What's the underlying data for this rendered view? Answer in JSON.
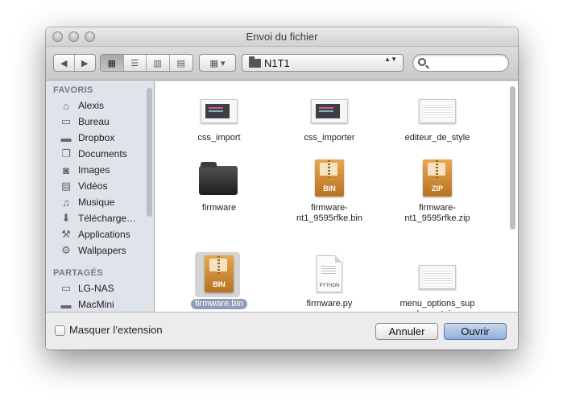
{
  "window": {
    "title": "Envoi du fichier"
  },
  "toolbar": {
    "location": "N1T1",
    "search_placeholder": "",
    "nav_back": "◀",
    "nav_forward": "▶",
    "view_icons": "▦",
    "view_list": "☰",
    "view_columns": "▥",
    "view_coverflow": "▤",
    "arrange": "▦ ▾",
    "location_arrows": "▲▼"
  },
  "sidebar": {
    "sections": [
      {
        "title": "FAVORIS",
        "items": [
          {
            "label": "Alexis",
            "icon": "home-icon"
          },
          {
            "label": "Bureau",
            "icon": "desktop-icon"
          },
          {
            "label": "Dropbox",
            "icon": "folder-icon"
          },
          {
            "label": "Documents",
            "icon": "documents-icon"
          },
          {
            "label": "Images",
            "icon": "camera-icon"
          },
          {
            "label": "Vidéos",
            "icon": "film-icon"
          },
          {
            "label": "Musique",
            "icon": "music-icon"
          },
          {
            "label": "Télécharge…",
            "icon": "download-icon"
          },
          {
            "label": "Applications",
            "icon": "applications-icon"
          },
          {
            "label": "Wallpapers",
            "icon": "gear-icon"
          }
        ]
      },
      {
        "title": "PARTAGÉS",
        "items": [
          {
            "label": "LG-NAS",
            "icon": "monitor-icon"
          },
          {
            "label": "MacMini",
            "icon": "mac-icon"
          }
        ]
      }
    ]
  },
  "files": [
    {
      "name": "css_import",
      "kind": "screenshot-dark"
    },
    {
      "name": "css_importer",
      "kind": "screenshot-dark"
    },
    {
      "name": "editeur_de_style",
      "kind": "screenshot-light"
    },
    {
      "name": "firmware",
      "kind": "folder"
    },
    {
      "name": "firmware-\nnt1_9595rfke.bin",
      "kind": "archive",
      "tag": "BIN"
    },
    {
      "name": "firmware-\nnt1_9595rfke.zip",
      "kind": "archive",
      "tag": "ZIP"
    },
    {
      "name": "firmware.bin",
      "kind": "archive",
      "tag": "BIN",
      "selected": true
    },
    {
      "name": "firmware.py",
      "kind": "document",
      "tag": "PYTHON"
    },
    {
      "name": "menu_options_sup\nplementaires",
      "kind": "screenshot-light"
    }
  ],
  "footer": {
    "hide_extension_label": "Masquer l’extension",
    "hide_extension_checked": false,
    "cancel_label": "Annuler",
    "open_label": "Ouvrir"
  }
}
